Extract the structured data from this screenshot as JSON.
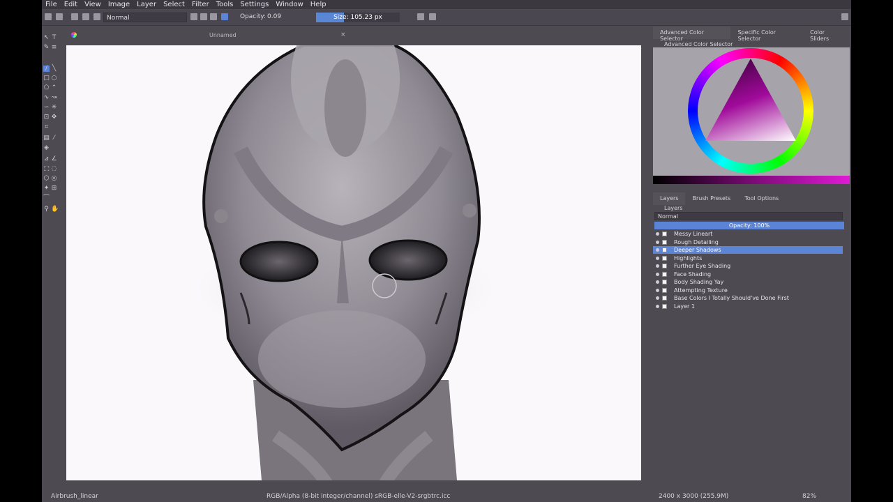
{
  "menu": [
    "File",
    "Edit",
    "View",
    "Image",
    "Layer",
    "Select",
    "Filter",
    "Tools",
    "Settings",
    "Window",
    "Help"
  ],
  "toolbar": {
    "blend_mode": "Normal",
    "opacity_label": "Opacity:",
    "opacity_value": "0.09",
    "size_label": "Size:",
    "size_value": "105.23 px"
  },
  "document": {
    "title": "Unnamed",
    "close": "×"
  },
  "panels": {
    "color_tabs": [
      "Advanced Color Selector",
      "Specific Color Selector",
      "Color Sliders"
    ],
    "color_docker_title": "Advanced Color Selector",
    "layer_tabs": [
      "Layers",
      "Brush Presets",
      "Tool Options"
    ],
    "layers_title": "Layers",
    "layers_blend": "Normal",
    "layers_opacity": "Opacity:  100%"
  },
  "layers": [
    {
      "name": "Messy Lineart",
      "selected": false
    },
    {
      "name": "Rough Detailing",
      "selected": false
    },
    {
      "name": "Deeper Shadows",
      "selected": true
    },
    {
      "name": "Highlights",
      "selected": false
    },
    {
      "name": "Further Eye Shading",
      "selected": false
    },
    {
      "name": "Face Shading",
      "selected": false
    },
    {
      "name": "Body Shading Yay",
      "selected": false
    },
    {
      "name": "Attempting Texture",
      "selected": false
    },
    {
      "name": "Base Colors I Totally Should've Done First",
      "selected": false
    },
    {
      "name": "Layer 1",
      "selected": false
    }
  ],
  "status": {
    "brush": "Airbrush_linear",
    "color_space": "RGB/Alpha (8-bit integer/channel)  sRGB-elle-V2-srgbtrc.icc",
    "dimensions": "2400 x 3000 (255.9M)",
    "zoom": "82%"
  },
  "colors": {
    "accent": "#5b84d6",
    "canvas": "#fbf8fc",
    "ui": "#4d4a52"
  }
}
